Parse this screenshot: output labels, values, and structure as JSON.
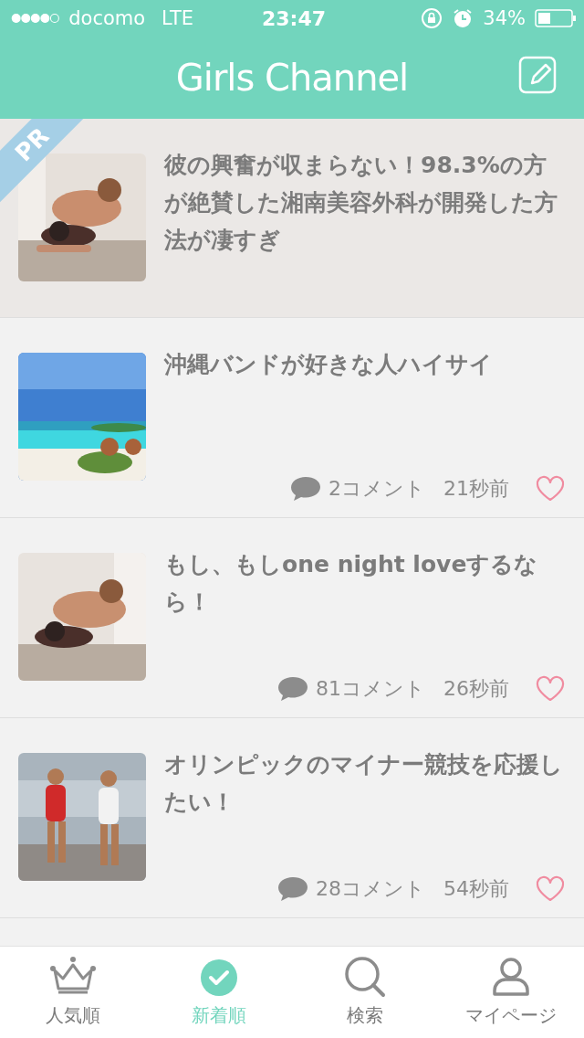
{
  "status_bar": {
    "carrier": "docomo",
    "network": "LTE",
    "time": "23:47",
    "battery": "34%"
  },
  "nav": {
    "title": "Girls Channel"
  },
  "articles": [
    {
      "kind": "ad",
      "badge": "PR",
      "title": "彼の興奮が収まらない！98.3%の方が絶賛した湘南美容外科が開発した方法が凄すぎ"
    },
    {
      "kind": "topic",
      "title": "沖縄バンドが好きな人ハイサイ",
      "comments": "2コメント",
      "time": "21秒前"
    },
    {
      "kind": "topic",
      "title": "もし、もしone night loveするなら！",
      "comments": "81コメント",
      "time": "26秒前"
    },
    {
      "kind": "topic",
      "title": "オリンピックのマイナー競技を応援したい！",
      "comments": "28コメント",
      "time": "54秒前"
    }
  ],
  "tabs": [
    {
      "label": "人気順",
      "selected": false
    },
    {
      "label": "新着順",
      "selected": true
    },
    {
      "label": "検索",
      "selected": false
    },
    {
      "label": "マイページ",
      "selected": false
    }
  ]
}
